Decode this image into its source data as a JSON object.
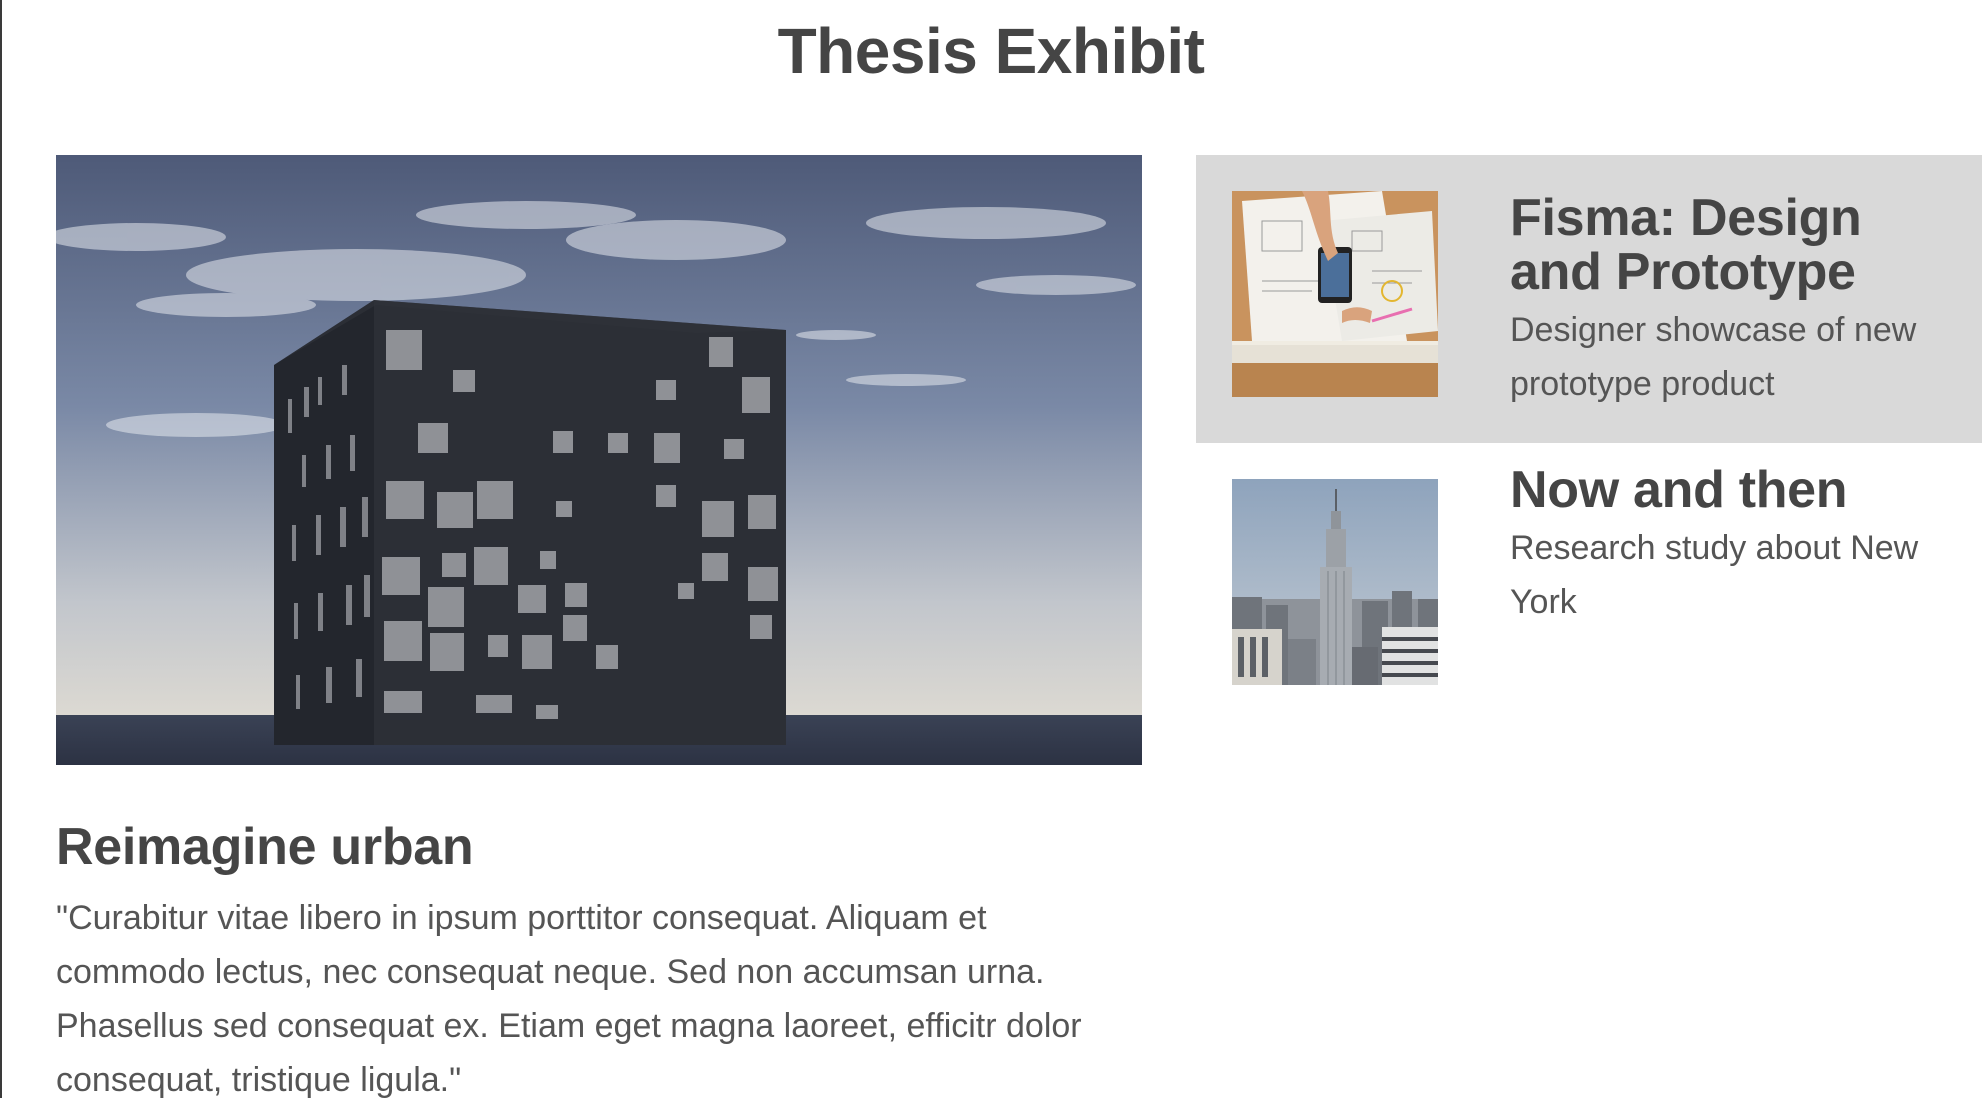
{
  "page": {
    "title": "Thesis Exhibit"
  },
  "feature": {
    "image": "cube-building-photo",
    "title": "Reimagine urban",
    "description": "\"Curabitur vitae libero in ipsum porttitor consequat. Aliquam et commodo lectus, nec consequat neque. Sed non accumsan urna. Phasellus sed consequat ex. Etiam eget magna laoreet, efficitr dolor consequat, tristique ligula.\""
  },
  "cards": [
    {
      "image": "desk-phone-sketches-photo",
      "title": "Fisma: Design and Prototype",
      "description": "Designer showcase of new prototype product",
      "active": true
    },
    {
      "image": "new-york-skyline-photo",
      "title": "Now and then",
      "description": "Research study about New York",
      "active": false
    }
  ],
  "colors": {
    "text_heading": "#454545",
    "text_body": "#555555",
    "card_highlight": "#d9d9d9",
    "background": "#ffffff"
  }
}
